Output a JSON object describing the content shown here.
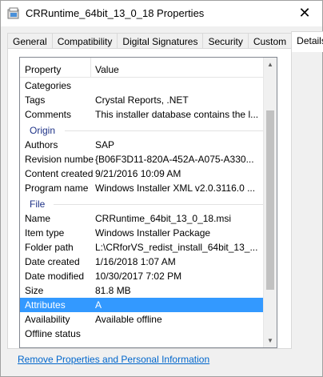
{
  "window": {
    "title": "CRRuntime_64bit_13_0_18 Properties",
    "close_glyph": "✕"
  },
  "tabs": [
    {
      "label": "General",
      "active": false
    },
    {
      "label": "Compatibility",
      "active": false
    },
    {
      "label": "Digital Signatures",
      "active": false
    },
    {
      "label": "Security",
      "active": false
    },
    {
      "label": "Custom",
      "active": false
    },
    {
      "label": "Details",
      "active": true
    }
  ],
  "details": {
    "columns": {
      "property": "Property",
      "value": "Value"
    },
    "rows_top": [
      {
        "name": "Categories",
        "value": ""
      },
      {
        "name": "Tags",
        "value": "Crystal Reports, .NET"
      },
      {
        "name": "Comments",
        "value": "This installer database contains the l..."
      }
    ],
    "group_origin": "Origin",
    "rows_origin": [
      {
        "name": "Authors",
        "value": "SAP"
      },
      {
        "name": "Revision number",
        "value": "{B06F3D11-820A-452A-A075-A330..."
      },
      {
        "name": "Content created",
        "value": "9/21/2016 10:09 AM"
      },
      {
        "name": "Program name",
        "value": "Windows Installer XML v2.0.3116.0 ..."
      }
    ],
    "group_file": "File",
    "rows_file": [
      {
        "name": "Name",
        "value": "CRRuntime_64bit_13_0_18.msi"
      },
      {
        "name": "Item type",
        "value": "Windows Installer Package"
      },
      {
        "name": "Folder path",
        "value": "L:\\CRforVS_redist_install_64bit_13_..."
      },
      {
        "name": "Date created",
        "value": "1/16/2018 1:07 AM"
      },
      {
        "name": "Date modified",
        "value": "10/30/2017 7:02 PM"
      },
      {
        "name": "Size",
        "value": "81.8 MB"
      },
      {
        "name": "Attributes",
        "value": "A",
        "selected": true
      },
      {
        "name": "Availability",
        "value": "Available offline"
      },
      {
        "name": "Offline status",
        "value": ""
      }
    ]
  },
  "footer": {
    "link": "Remove Properties and Personal Information"
  },
  "colors": {
    "selection": "#3399ff",
    "group_text": "#1e3287",
    "link": "#0066cc"
  }
}
